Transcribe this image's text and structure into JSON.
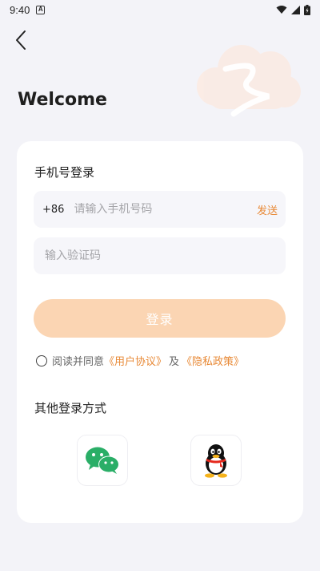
{
  "status_bar": {
    "time": "9:40",
    "notification_letter": "A",
    "icons": [
      "wifi-icon",
      "signal-icon",
      "battery-icon"
    ]
  },
  "header": {
    "back_icon": "chevron-left-icon",
    "welcome": "Welcome"
  },
  "login_card": {
    "title": "手机号登录",
    "phone": {
      "prefix": "+86",
      "placeholder": "请输入手机号码",
      "value": "",
      "send_label": "发送"
    },
    "code": {
      "placeholder": "输入验证码",
      "value": ""
    },
    "login_label": "登录",
    "agreement": {
      "checked": false,
      "prefix": "阅读并同意",
      "user_agreement": "《用户协议》",
      "and": "及",
      "privacy_policy": "《隐私政策》"
    },
    "other_methods_title": "其他登录方式",
    "social": [
      {
        "name": "wechat-icon"
      },
      {
        "name": "qq-icon"
      }
    ]
  },
  "colors": {
    "accent": "#e88936",
    "button_disabled": "#fbd5b3",
    "background": "#f3f3f8",
    "card": "#ffffff",
    "input_bg": "#f6f6fa",
    "wechat_green": "#2aae67"
  }
}
